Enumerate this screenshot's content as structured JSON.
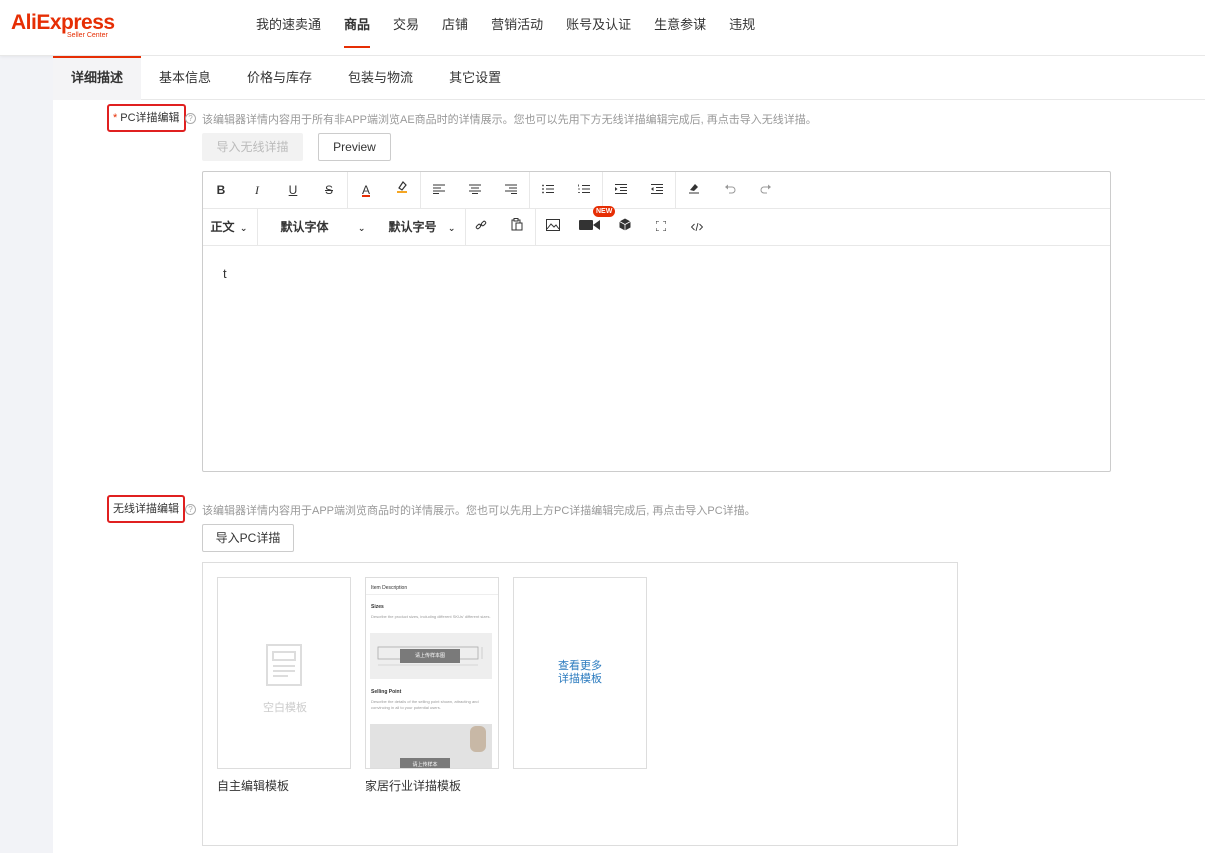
{
  "header": {
    "brand": "AliExpress",
    "brand_sub": "Seller Center",
    "nav": [
      {
        "label": "我的速卖通",
        "active": false
      },
      {
        "label": "商品",
        "active": true
      },
      {
        "label": "交易",
        "active": false
      },
      {
        "label": "店铺",
        "active": false
      },
      {
        "label": "营销活动",
        "active": false
      },
      {
        "label": "账号及认证",
        "active": false
      },
      {
        "label": "生意参谋",
        "active": false
      },
      {
        "label": "违规",
        "active": false
      }
    ]
  },
  "subtabs": [
    {
      "label": "详细描述",
      "active": true
    },
    {
      "label": "基本信息",
      "active": false
    },
    {
      "label": "价格与库存",
      "active": false
    },
    {
      "label": "包装与物流",
      "active": false
    },
    {
      "label": "其它设置",
      "active": false
    }
  ],
  "pc_section": {
    "required_mark": "*",
    "label": "PC详描编辑",
    "hint": "该编辑器详情内容用于所有非APP端浏览AE商品时的详情展示。您也可以先用下方无线详描编辑完成后, 再点击导入无线详描。",
    "import_button": "导入无线详描",
    "preview_button": "Preview"
  },
  "editor": {
    "bold": "B",
    "italic": "I",
    "underline": "U",
    "strike": "S",
    "font_color": "A",
    "paragraph_select": "正文",
    "font_family_select": "默认字体",
    "font_size_select": "默认字号",
    "new_badge": "NEW",
    "content": "t"
  },
  "mobile_section": {
    "label": "无线详描编辑",
    "hint": "该编辑器详情内容用于APP端浏览商品时的详情展示。您也可以先用上方PC详描编辑完成后, 再点击导入PC详描。",
    "import_button": "导入PC详描"
  },
  "templates": {
    "blank_label": "空白模板",
    "items": [
      {
        "caption": "自主编辑模板"
      },
      {
        "caption": "家居行业详描模板"
      }
    ],
    "sample": {
      "title": "Item Description",
      "sizes_heading": "Sizes",
      "sizes_text": "Describe the product sizes, including different SKUs' different sizes.",
      "banner1": "请上传样本图",
      "selling_heading": "Selling Point",
      "selling_text": "Describe the details of the selling point shown, attracting and convincing in all to your potential users.",
      "banner2": "请上传样本"
    },
    "more_line1": "查看更多",
    "more_line2": "详描模板"
  },
  "colors": {
    "accent": "#e62e04",
    "highlight_box": "#e02020",
    "link": "#2b7bbf"
  }
}
